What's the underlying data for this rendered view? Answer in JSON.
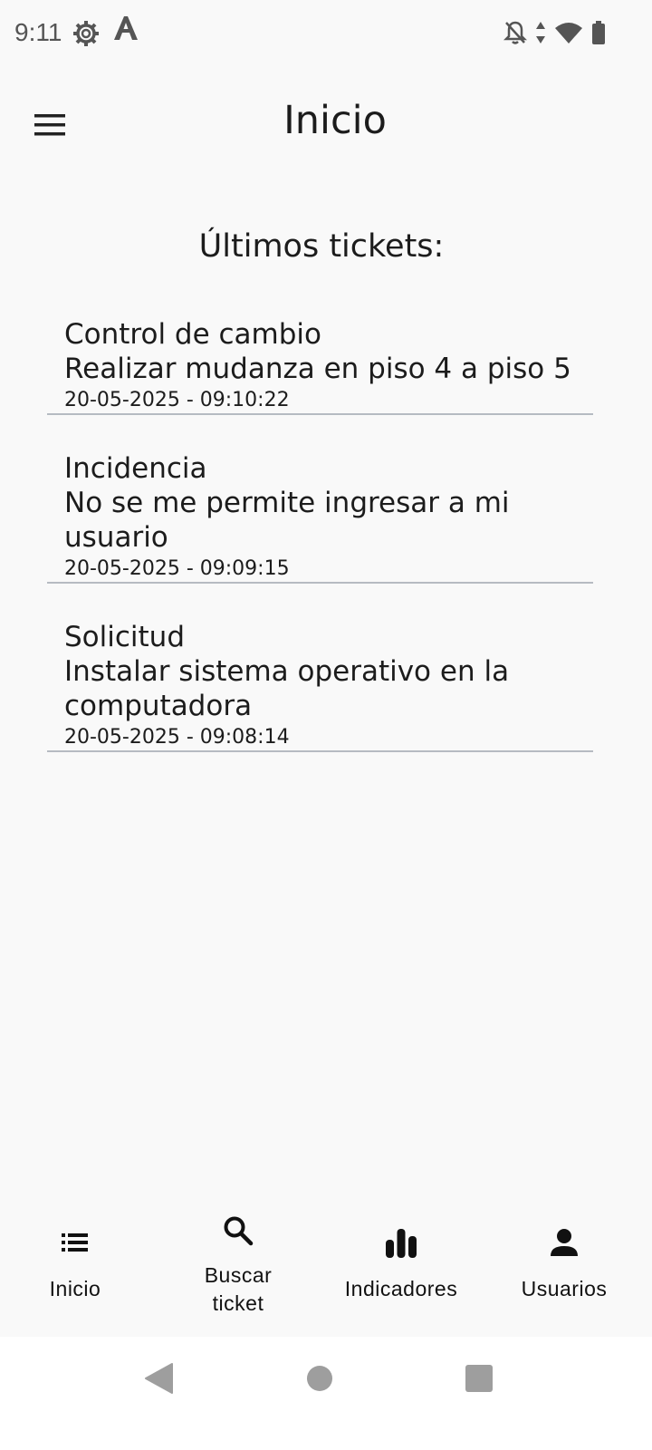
{
  "status_bar": {
    "time": "9:11",
    "icons": [
      "settings-gear-icon",
      "font-a-icon",
      "notifications-off-icon",
      "data-arrows-icon",
      "wifi-icon",
      "battery-icon"
    ]
  },
  "app_bar": {
    "menu_icon": "menu-hamburger-icon",
    "title": "Inicio"
  },
  "main": {
    "section_title": "Últimos tickets:",
    "tickets": [
      {
        "type": "Control de cambio",
        "description": "Realizar mudanza en piso 4 a piso 5",
        "datetime": "20-05-2025 - 09:10:22"
      },
      {
        "type": "Incidencia",
        "description": "No se me permite ingresar a mi usuario",
        "datetime": "20-05-2025 - 09:09:15"
      },
      {
        "type": "Solicitud",
        "description": "Instalar sistema operativo en la computadora",
        "datetime": "20-05-2025 - 09:08:14"
      }
    ]
  },
  "bottom_nav": {
    "items": [
      {
        "label": "Inicio",
        "icon": "list-icon"
      },
      {
        "label_line1": "Buscar",
        "label_line2": "ticket",
        "icon": "search-icon"
      },
      {
        "label": "Indicadores",
        "icon": "bar-chart-icon"
      },
      {
        "label": "Usuarios",
        "icon": "person-icon"
      }
    ]
  },
  "system_nav": {
    "icons": [
      "back-icon",
      "home-icon",
      "recents-icon"
    ]
  },
  "colors": {
    "background": "#f9f9f9",
    "text": "#1c1c1c",
    "divider": "#b6bbc2",
    "system_icons": "#9e9e9e"
  }
}
